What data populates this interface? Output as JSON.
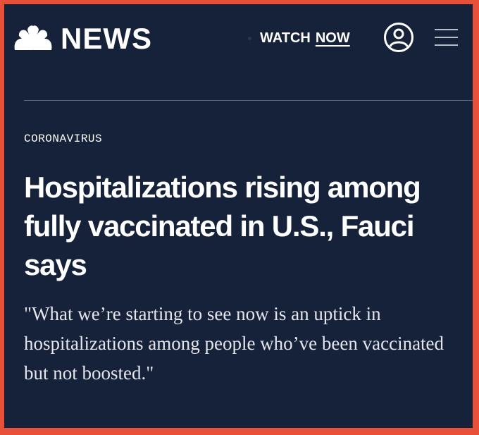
{
  "header": {
    "logo_text": "NEWS",
    "watch_label": "WATCH",
    "now_label": "NOW",
    "account_icon": "account-icon",
    "menu_icon": "hamburger-menu-icon"
  },
  "article": {
    "category": "CORONAVIRUS",
    "headline": "Hospitalizations rising among fully vaccinated in U.S., Fauci says",
    "dek": "\"What we’re starting to see now is an uptick in hospitalizations among people who’ve been vaccinated but not boosted.\""
  },
  "colors": {
    "background": "#16213a",
    "border": "#e8503a",
    "text": "#ffffff"
  }
}
